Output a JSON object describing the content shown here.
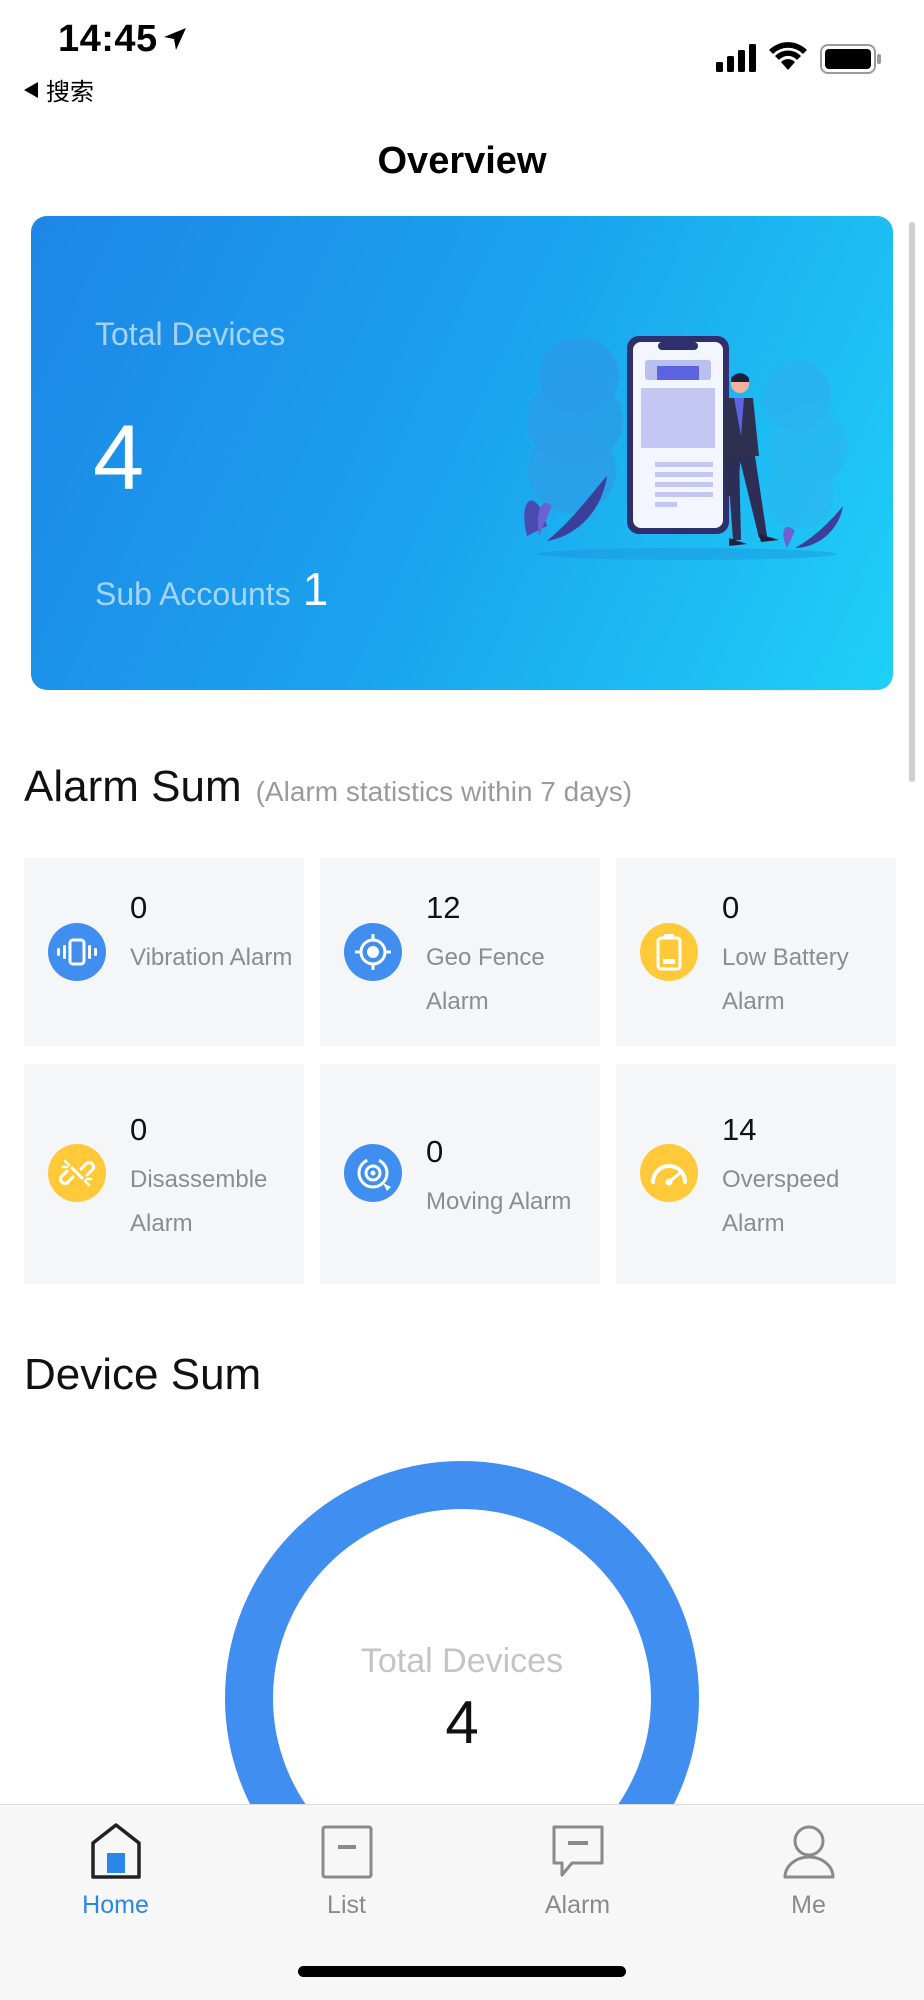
{
  "status_bar": {
    "time": "14:45",
    "back_label": "搜索"
  },
  "nav": {
    "title": "Overview"
  },
  "hero": {
    "total_label": "Total Devices",
    "total_value": "4",
    "sub_label": "Sub Accounts",
    "sub_value": "1"
  },
  "alarm_sum": {
    "title": "Alarm Sum",
    "note": "(Alarm statistics within 7 days)",
    "tiles": [
      {
        "count": "0",
        "label": "Vibration Alarm",
        "icon": "vibration-icon",
        "color": "#3f8ef0"
      },
      {
        "count": "12",
        "label": "Geo Fence Alarm",
        "icon": "geo-fence-icon",
        "color": "#3f8ef0"
      },
      {
        "count": "0",
        "label": "Low Battery Alarm",
        "icon": "low-battery-icon",
        "color": "#ffc93a"
      },
      {
        "count": "0",
        "label": "Disassemble Alarm",
        "icon": "broken-link-icon",
        "color": "#ffc93a"
      },
      {
        "count": "0",
        "label": "Moving Alarm",
        "icon": "moving-icon",
        "color": "#3f8ef0"
      },
      {
        "count": "14",
        "label": "Overspeed Alarm",
        "icon": "speedometer-icon",
        "color": "#ffc93a"
      }
    ]
  },
  "device_sum": {
    "title": "Device Sum",
    "center_label": "Total Devices",
    "center_value": "4",
    "ring_color": "#3f8ef0"
  },
  "tab_bar": {
    "tabs": [
      {
        "label": "Home",
        "icon": "home-icon",
        "active": true
      },
      {
        "label": "List",
        "icon": "list-icon",
        "active": false
      },
      {
        "label": "Alarm",
        "icon": "message-icon",
        "active": false
      },
      {
        "label": "Me",
        "icon": "user-icon",
        "active": false
      }
    ],
    "active_color": "#2a86e8"
  }
}
